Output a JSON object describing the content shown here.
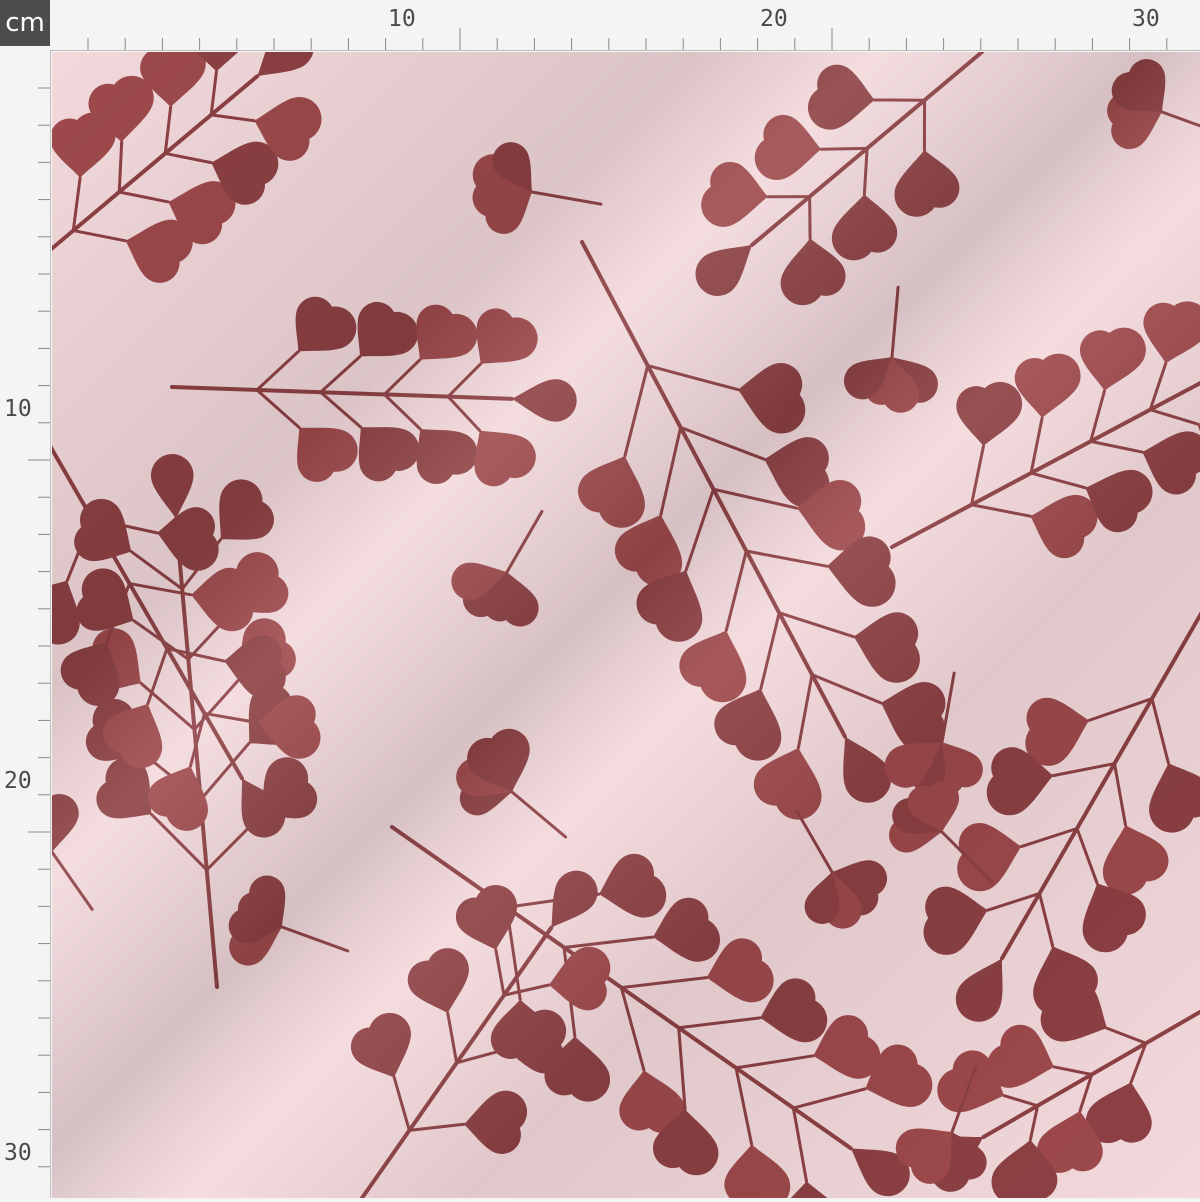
{
  "ruler": {
    "unit": "cm",
    "top_labels": [
      "10",
      "20",
      "30"
    ],
    "left_labels": [
      "10",
      "20",
      "30"
    ]
  },
  "fabric": {
    "background_color": "#f3d9dc",
    "shadow_color": "#c9a7ac",
    "motif_color": "#8e4144",
    "motif_color_light": "#9f4a4c",
    "motif": "berry-sprig-pattern"
  }
}
